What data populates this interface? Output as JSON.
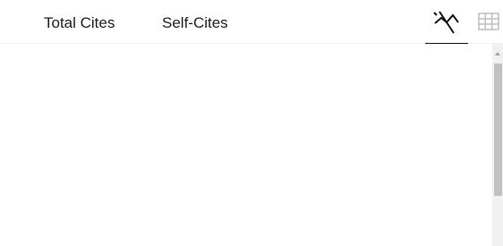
{
  "tabs": {
    "total_cites": "Total Cites",
    "self_cites": "Self-Cites"
  },
  "view_toggle": {
    "active": "chart",
    "chart_icon": "chart-line-icon",
    "table_icon": "table-grid-icon"
  },
  "colors": {
    "active_icon": "#111111",
    "inactive_icon": "#bdbdbd",
    "scrollbar_thumb": "#c1c1c1"
  }
}
